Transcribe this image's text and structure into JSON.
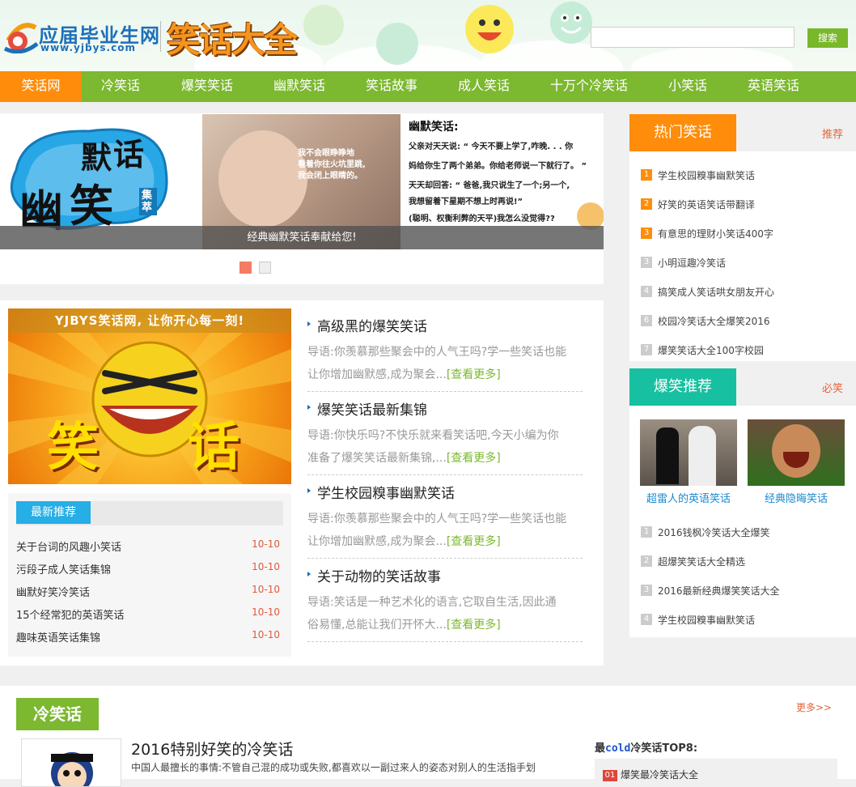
{
  "header": {
    "logo_text": "应届毕业生网",
    "logo_url": "www.yjbys.com",
    "site_title": "笑话大全",
    "search_placeholder": "",
    "search_button": "搜索"
  },
  "nav": {
    "items": [
      {
        "label": "笑话网",
        "active": true
      },
      {
        "label": "冷笑话"
      },
      {
        "label": "爆笑笑话"
      },
      {
        "label": "幽默笑话"
      },
      {
        "label": "笑话故事"
      },
      {
        "label": "成人笑话"
      },
      {
        "label": "十万个冷笑话"
      },
      {
        "label": "小笑话"
      },
      {
        "label": "英语笑话"
      }
    ]
  },
  "banner": {
    "left_art_text": [
      "幽",
      "默",
      "笑",
      "话",
      "集萃"
    ],
    "photo_text": [
      "我不会眼睁睁地",
      "看着你往火坑里跳,",
      "我会闭上眼睛的。"
    ],
    "joke_title": "幽默笑话:",
    "joke_lines": [
      "父亲对天天说: “ 今天不要上学了,咋晚. . . 你",
      "妈给你生了两个弟弟。你给老师说一下就行了。 ”",
      "天天却回答: “ 爸爸,我只说生了一个;另一个,",
      "我想留着下星期不想上时再说!”",
      "(聪明、权衡利弊的天平)我怎么没觉得??"
    ],
    "caption": "经典幽默笑话奉献给您!",
    "slide_count": 2,
    "active_slide": 0,
    "colors": {
      "active_dot": "#f47c62",
      "inactive_dot": "#eeeeee"
    }
  },
  "promo": {
    "banner_text": "YJBYS笑话网, 让你开心每一刻!",
    "art_text": [
      "笑",
      "话"
    ]
  },
  "latest": {
    "tab_label": "最新推荐",
    "items": [
      {
        "title": "关于台词的风趣小笑话",
        "date": "10-10"
      },
      {
        "title": "污段子成人笑话集锦",
        "date": "10-10"
      },
      {
        "title": "幽默好笑冷笑话",
        "date": "10-10"
      },
      {
        "title": "15个经常犯的英语笑话",
        "date": "10-10"
      },
      {
        "title": "趣味英语笑话集锦",
        "date": "10-10"
      }
    ]
  },
  "articles": [
    {
      "title": "高级黑的爆笑笑话",
      "line1": "导语:你羡慕那些聚会中的人气王吗?学一些笑话也能",
      "line2": "让你增加幽默感,成为聚会...",
      "more": "[查看更多]"
    },
    {
      "title": "爆笑笑话最新集锦",
      "line1": "导语:你快乐吗?不快乐就来看笑话吧,今天小编为你",
      "line2": "准备了爆笑笑话最新集锦,...",
      "more": "[查看更多]"
    },
    {
      "title": "学生校园糗事幽默笑话",
      "line1": "导语:你羡慕那些聚会中的人气王吗?学一些笑话也能",
      "line2": "让你增加幽默感,成为聚会...",
      "more": "[查看更多]"
    },
    {
      "title": "关于动物的笑话故事",
      "line1": "导语:笑话是一种艺术化的语言,它取自生活,因此通",
      "line2": "俗易懂,总能让我们开怀大...",
      "more": "[查看更多]"
    }
  ],
  "hot": {
    "tab_label": "热门笑话",
    "more_label": "推荐",
    "colors": {
      "tab": "#ff8c0a",
      "top_rank": "#ff8c0a",
      "rank": "#cccccc"
    },
    "items": [
      {
        "num": "1",
        "title": "学生校园糗事幽默笑话"
      },
      {
        "num": "2",
        "title": "好笑的英语笑话带翻译"
      },
      {
        "num": "3",
        "title": "有意思的理财小笑话400字"
      },
      {
        "num": "3",
        "title": "小明逗趣冷笑话"
      },
      {
        "num": "4",
        "title": "搞笑成人笑话哄女朋友开心"
      },
      {
        "num": "6",
        "title": "校园冷笑话大全爆笑2016"
      },
      {
        "num": "7",
        "title": "爆笑笑话大全100字校园"
      }
    ]
  },
  "hot2": {
    "tab_label": "爆笑推荐",
    "more_label": "必笑",
    "colors": {
      "tab": "#16c0a0"
    },
    "pics": [
      {
        "caption": "超雷人的英语笑话"
      },
      {
        "caption": "经典隐晦笑话"
      }
    ],
    "items": [
      {
        "num": "1",
        "title": "2016钱枫冷笑话大全爆笑"
      },
      {
        "num": "2",
        "title": "超爆笑笑话大全精选"
      },
      {
        "num": "3",
        "title": "2016最新经典爆笑笑话大全"
      },
      {
        "num": "4",
        "title": "学生校园糗事幽默笑话"
      }
    ]
  },
  "cold": {
    "tab_label": "冷笑话",
    "more_label": "更多>>",
    "title": "2016特别好笑的冷笑话",
    "desc": "中国人最擅长的事情:不管自己混的成功或失败,都喜欢以一副过来人的姿态对别人的生活指手划",
    "top8_pre": "最",
    "top8_cold": "cold",
    "top8_post": "冷笑话TOP8:",
    "top8_first_num": "01",
    "top8_first": "爆笑最冷笑话大全"
  }
}
